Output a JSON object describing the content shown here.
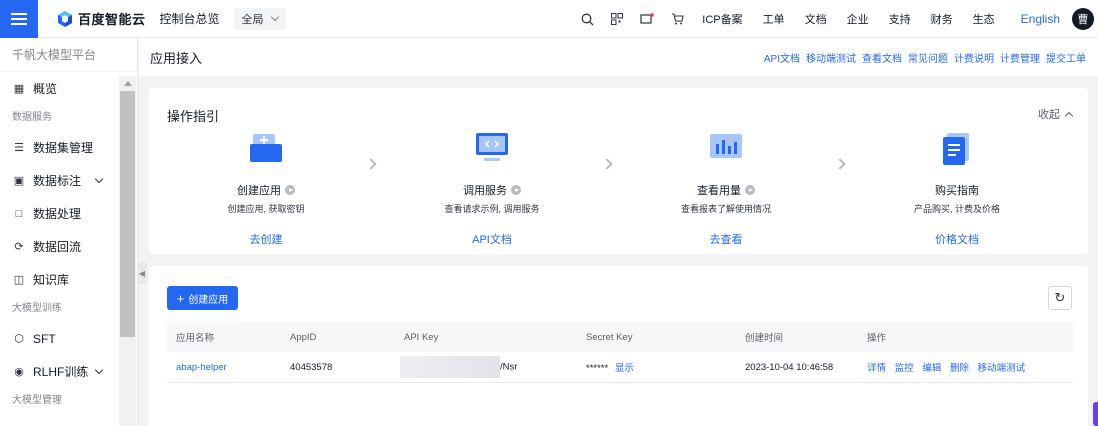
{
  "header": {
    "logo_text": "百度智能云",
    "console": "控制台总览",
    "region": "全局",
    "nav": [
      "ICP备案",
      "工单",
      "文档",
      "企业",
      "支持",
      "财务",
      "生态"
    ],
    "language": "English",
    "avatar_initial": "曹"
  },
  "sidebar": {
    "title": "千帆大模型平台",
    "overview": "概览",
    "group_data": "数据服务",
    "items_data": [
      "数据集管理",
      "数据标注",
      "数据处理",
      "数据回流",
      "知识库"
    ],
    "group_training": "大模型训练",
    "items_training": [
      "SFT",
      "RLHF训练"
    ],
    "group_manage": "大模型管理"
  },
  "page": {
    "title": "应用接入",
    "doc_links": [
      "API文档",
      "移动端测试",
      "查看文档",
      "常见问题",
      "计费说明",
      "计费管理",
      "提交工单"
    ]
  },
  "guide": {
    "title": "操作指引",
    "collapse_label": "收起",
    "steps": [
      {
        "name": "创建应用",
        "desc": "创建应用, 获取密钥",
        "link": "去创建"
      },
      {
        "name": "调用服务",
        "desc": "查看请求示例, 调用服务",
        "link": "API文档"
      },
      {
        "name": "查看用量",
        "desc": "查看报表了解使用情况",
        "link": "去查看"
      },
      {
        "name": "购买指南",
        "desc": "产品购买, 计费及价格",
        "link": "价格文档"
      }
    ]
  },
  "apps": {
    "create_label": "创建应用",
    "columns": [
      "应用名称",
      "AppID",
      "API Key",
      "Secret Key",
      "创建时间",
      "操作"
    ],
    "rows": [
      {
        "name": "abap-helper",
        "app_id": "40453578",
        "api_key_suffix": "/Nsr",
        "secret_mask": "******",
        "show_label": "显示",
        "created": "2023-10-04 10:46:58",
        "actions": [
          "详情",
          "监控",
          "编辑",
          "删除",
          "移动端测试"
        ]
      }
    ]
  },
  "colors": {
    "brand": "#2468f2",
    "text": "#151b26",
    "muted": "#84868c",
    "bg": "#f2f3f5"
  },
  "icons": {
    "top": [
      "search-icon",
      "qrcode-icon",
      "message-icon",
      "cart-icon"
    ],
    "sidebar": [
      "grid-icon",
      "database-icon",
      "annotate-icon",
      "process-icon",
      "recycle-icon",
      "book-icon",
      "hexagon-icon",
      "rlhf-icon"
    ]
  }
}
